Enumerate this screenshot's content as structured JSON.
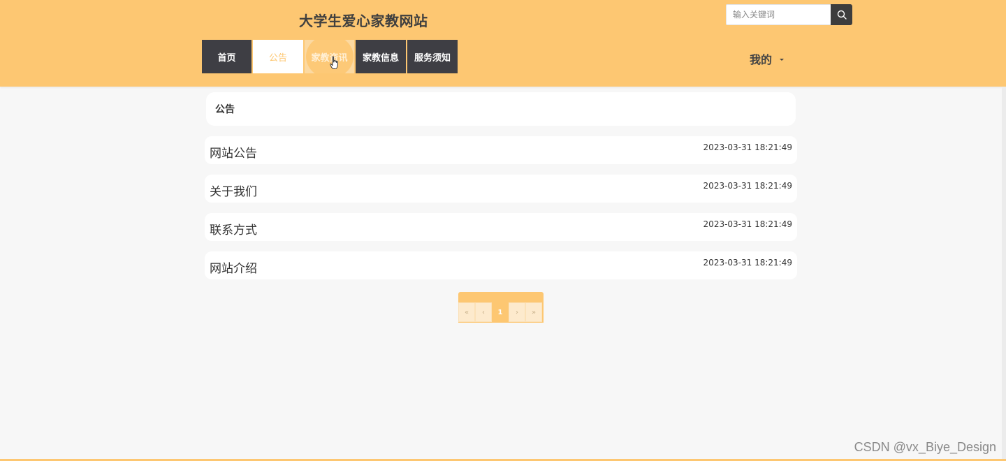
{
  "site": {
    "title": "大学生爱心家教网站"
  },
  "search": {
    "placeholder": "输入关键词",
    "icon": "search-icon"
  },
  "nav": {
    "items": [
      {
        "label": "首页",
        "state": "normal"
      },
      {
        "label": "公告",
        "state": "active"
      },
      {
        "label": "家教资讯",
        "state": "hovered"
      },
      {
        "label": "家教信息",
        "state": "normal"
      },
      {
        "label": "服务须知",
        "state": "normal"
      }
    ]
  },
  "user_menu": {
    "label": "我的"
  },
  "section": {
    "title": "公告"
  },
  "notices": [
    {
      "title": "网站公告",
      "time": "2023-03-31 18:21:49"
    },
    {
      "title": "关于我们",
      "time": "2023-03-31 18:21:49"
    },
    {
      "title": "联系方式",
      "time": "2023-03-31 18:21:49"
    },
    {
      "title": "网站介绍",
      "time": "2023-03-31 18:21:49"
    }
  ],
  "pagination": {
    "first": "«",
    "prev": "‹",
    "current": "1",
    "next": "›",
    "last": "»"
  },
  "watermark": "CSDN @vx_Biye_Design",
  "colors": {
    "accent": "#fdc772",
    "nav_dark": "#3e3e44",
    "background": "#f7f7f7"
  }
}
